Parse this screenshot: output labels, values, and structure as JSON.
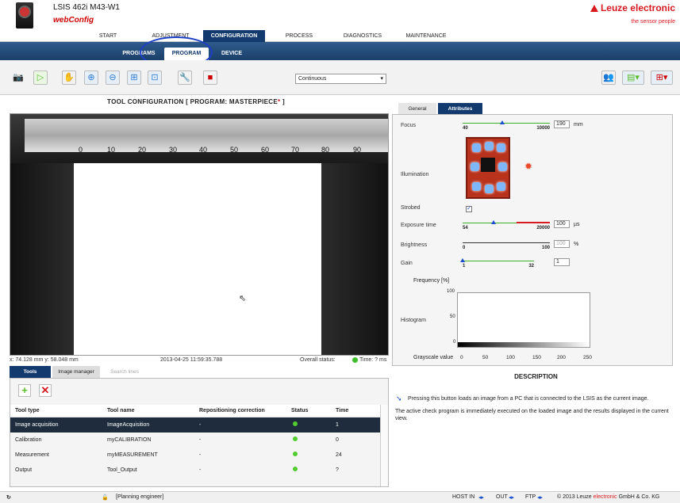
{
  "header": {
    "device_title": "LSIS 462i M43-W1",
    "webconfig": "webConfig",
    "brand": "Leuze electronic",
    "slogan": "the sensor people"
  },
  "topnav": [
    "START",
    "ADJUSTMENT",
    "CONFIGURATION",
    "PROCESS",
    "DIAGNOSTICS",
    "MAINTENANCE"
  ],
  "subnav": [
    "PROGRAMS",
    "PROGRAM",
    "DEVICE"
  ],
  "toolbar": {
    "mode": "Continuous"
  },
  "tool_config": {
    "title": "TOOL CONFIGURATION   [ PROGRAM: MASTERPIECE",
    "star": "*",
    "close": " ]"
  },
  "ruler": [
    "0",
    "10",
    "20",
    "30",
    "40",
    "50",
    "60",
    "70",
    "80",
    "90"
  ],
  "status": {
    "coords": "x: 74.128 mm y: 58.048 mm",
    "timestamp": "2013-04-25 11:59:35.788",
    "overall": "Overall status:",
    "time": "Time: ? ms"
  },
  "bottom_tabs": [
    "Tools",
    "Image manager",
    "Search lines"
  ],
  "tools_table": {
    "headers": [
      "Tool type",
      "Tool name",
      "Repositioning correction",
      "Status",
      "Time"
    ],
    "rows": [
      {
        "type": "Image acquisition",
        "name": "ImageAcquisition",
        "repos": "-",
        "time": "1"
      },
      {
        "type": "Calibration",
        "name": "myCALIBRATION",
        "repos": "-",
        "time": "0"
      },
      {
        "type": "Measurement",
        "name": "myMEASUREMENT",
        "repos": "-",
        "time": "24"
      },
      {
        "type": "Output",
        "name": "Tool_Output",
        "repos": "-",
        "time": "?"
      }
    ]
  },
  "right_tabs": [
    "General",
    "Attributes"
  ],
  "attributes": {
    "focus": {
      "label": "Focus",
      "min": "40",
      "max": "10000",
      "value": "190",
      "unit": "mm",
      "level": 0.45
    },
    "illumination": "Illumination",
    "strobed": {
      "label": "Strobed",
      "checked": "✓"
    },
    "exposure": {
      "label": "Exposure time",
      "min": "54",
      "max": "20000",
      "value": "100",
      "unit": "µs",
      "level": 0.35
    },
    "brightness": {
      "label": "Brightness",
      "min": "0",
      "max": "100",
      "value": "100",
      "unit": "%"
    },
    "gain": {
      "label": "Gain",
      "min": "1",
      "max": "32",
      "value": "1",
      "level": 0.0
    },
    "frequency_label": "Frequency [%]",
    "histogram_label": "Histogram",
    "hist_y": [
      "100",
      "50",
      "0"
    ],
    "grayscale_label": "Grayscale value",
    "hist_x": [
      "0",
      "50",
      "100",
      "150",
      "200",
      "250"
    ]
  },
  "description": {
    "title": "DESCRIPTION",
    "line1": "Pressing this button loads an image from a PC that is connected to the LSIS as the current image.",
    "line2": "The active check program is immediately executed on the loaded image and the results displayed in the current view."
  },
  "footer": {
    "user": "[Planning engineer]",
    "host": "HOST IN",
    "out": "OUT",
    "ftp": "FTP",
    "copyright": "© 2013 Leuze",
    "copyright_brand": "electronic",
    "copyright_tail": "GmbH & Co. KG"
  }
}
